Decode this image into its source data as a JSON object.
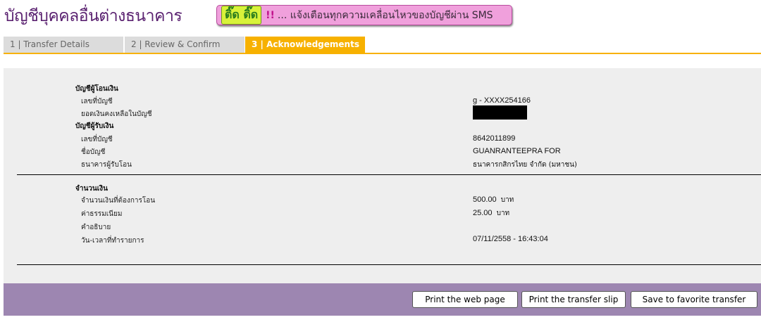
{
  "page": {
    "title": "บัญชีบุคคลอื่นต่างธนาคาร",
    "banner_tick": "ติ๊ด ติ๊ด",
    "banner_excl": "!!",
    "banner_text": "... แจ้งเตือนทุกความเคลื่อนไหวของบัญชีผ่าน SMS"
  },
  "tabs": [
    {
      "label": "1 | Transfer Details",
      "active": false
    },
    {
      "label": "2 | Review & Confirm",
      "active": false
    },
    {
      "label": "3 | Acknowledgements",
      "active": true
    }
  ],
  "from_account": {
    "heading": "บัญชีผู้โอนเงิน",
    "account_number_label": "เลขที่บัญชี",
    "account_number": "g - XXXX254166",
    "balance_label": "ยอดเงินคงเหลือในบัญชี"
  },
  "to_account": {
    "heading": "บัญชีผู้รับเงิน",
    "account_number_label": "เลขที่บัญชี",
    "account_number": "8642011899",
    "account_name_label": "ชื่อบัญชี",
    "account_name": "GUANRANTEEPRA FOR",
    "bank_label": "ธนาคารผู้รับโอน",
    "bank": "ธนาคารกสิกรไทย จำกัด (มหาชน)"
  },
  "amount": {
    "heading": "จำนวนเงิน",
    "transfer_label": "จำนวนเงินที่ต้องการโอน",
    "transfer_value": "500.00",
    "currency": "บาท",
    "fee_label": "ค่าธรรมเนียม",
    "fee_value": "25.00",
    "fee_currency": "บาท",
    "description_label": "คำอธิบาย",
    "datetime_label": "วัน-เวลาที่ทำรายการ",
    "datetime_value": "07/11/2558 - 16:43:04"
  },
  "buttons": {
    "print_page": "Print the web page",
    "print_slip": "Print the transfer slip",
    "save_favorite": "Save to favorite transfer"
  },
  "colors": {
    "title": "#5a2170",
    "active_tab": "#f7b100",
    "footer": "#9d86b1",
    "panel": "#eeeeee"
  }
}
